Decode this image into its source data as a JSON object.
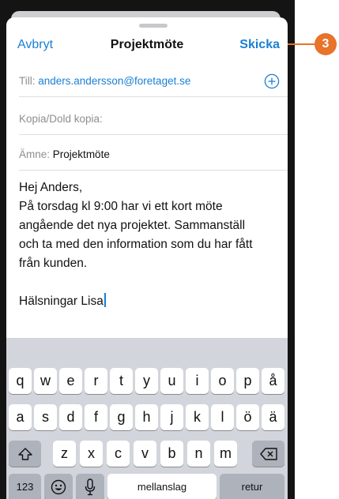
{
  "nav": {
    "cancel": "Avbryt",
    "title": "Projektmöte",
    "send": "Skicka"
  },
  "fields": {
    "to_label": "Till:",
    "to_value": "anders.andersson@foretaget.se",
    "cc_label": "Kopia/Dold kopia:",
    "subject_label": "Ämne:",
    "subject_value": "Projektmöte"
  },
  "body": {
    "lines": [
      "Hej Anders,",
      "På torsdag kl 9:00 har vi ett kort möte",
      "angående det nya projektet. Sammanställ",
      "och ta med den information som du har fått",
      "från kunden."
    ],
    "signature": "Hälsningar Lisa"
  },
  "keyboard": {
    "row1": [
      "q",
      "w",
      "e",
      "r",
      "t",
      "y",
      "u",
      "i",
      "o",
      "p",
      "å"
    ],
    "row2": [
      "a",
      "s",
      "d",
      "f",
      "g",
      "h",
      "j",
      "k",
      "l",
      "ö",
      "ä"
    ],
    "row3": [
      "z",
      "x",
      "c",
      "v",
      "b",
      "n",
      "m"
    ],
    "numbers": "123",
    "space": "mellanslag",
    "return": "retur"
  },
  "callout": {
    "number": "3"
  },
  "colors": {
    "accent": "#1a7fd4",
    "callout": "#e8732a",
    "keyboard_bg": "#d2d5db"
  }
}
